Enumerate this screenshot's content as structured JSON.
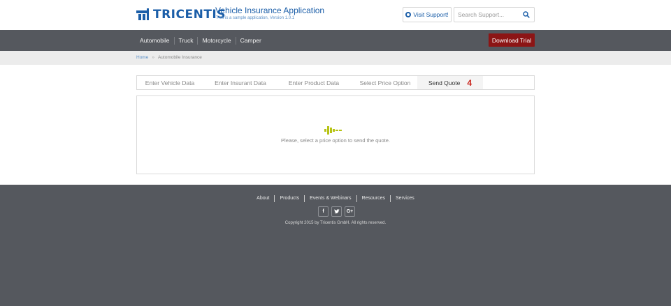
{
  "header": {
    "logo_text": "TRICENTIS",
    "app_title": "Vehicle Insurance Application",
    "app_subtitle": "This is a sample application, Version 1.0.1",
    "visit_support_label": "Visit Support!",
    "search_placeholder": "Search Support..."
  },
  "nav": {
    "items": [
      "Automobile",
      "Truck",
      "Motorcycle",
      "Camper"
    ],
    "download_label": "Download Trial"
  },
  "breadcrumb": {
    "home": "Home",
    "separator": "»",
    "current": "Automobile Insurance"
  },
  "wizard": {
    "tabs": [
      {
        "label": "Enter Vehicle Data"
      },
      {
        "label": "Enter Insurant Data"
      },
      {
        "label": "Enter Product Data"
      },
      {
        "label": "Select Price Option"
      },
      {
        "label": "Send Quote",
        "badge": "4"
      }
    ]
  },
  "content": {
    "message": "Please, select a price option to send the quote."
  },
  "footer": {
    "links": [
      "About",
      "Products",
      "Events & Webinars",
      "Resources",
      "Services"
    ],
    "social": [
      {
        "icon": "facebook-icon",
        "glyph": "f"
      },
      {
        "icon": "twitter-icon",
        "glyph": "t"
      },
      {
        "icon": "google-plus-icon",
        "glyph": "G+"
      }
    ],
    "copyright": "Copyright 2015 by Tricentis GmbH. All rights reserved."
  },
  "colors": {
    "brand_blue": "#1b5ea8",
    "nav_bg": "#55585e",
    "download_red": "#8c1515",
    "loader_green": "#b7c315",
    "step_number_red": "#c9241c"
  }
}
